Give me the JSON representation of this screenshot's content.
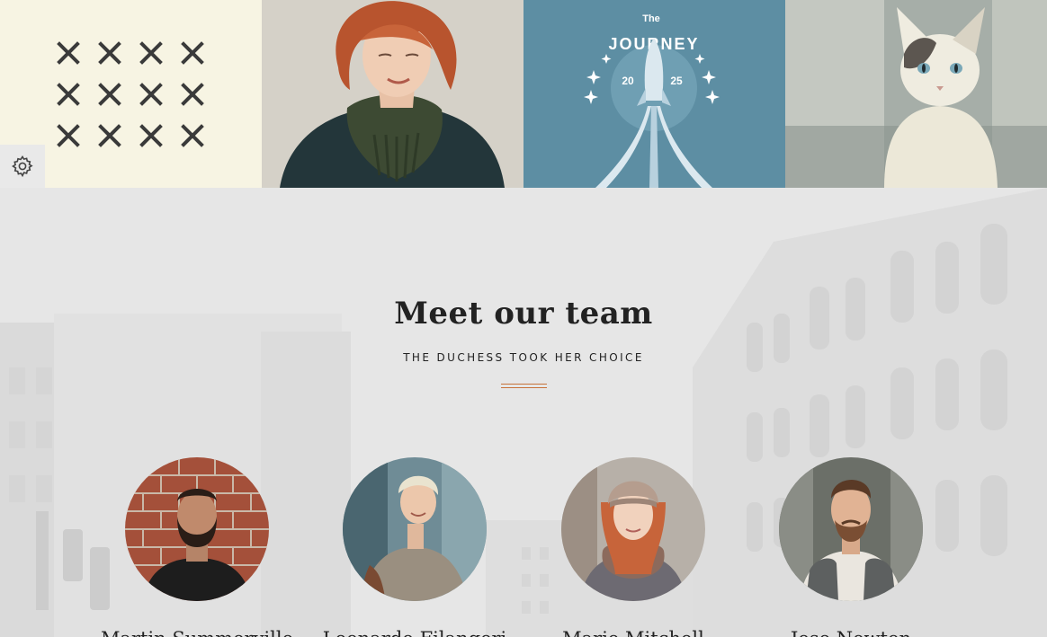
{
  "settings": {
    "icon": "gear-icon"
  },
  "portfolio": {
    "items": [
      {
        "type": "pattern",
        "icon": "x-pattern"
      },
      {
        "type": "photo",
        "subject": "woman"
      },
      {
        "type": "poster",
        "title_small": "The",
        "title_large": "JOURNEY",
        "year_left": "20",
        "year_right": "25"
      },
      {
        "type": "photo",
        "subject": "cat"
      }
    ]
  },
  "team": {
    "title": "Meet our team",
    "subtitle": "THE DUCHESS TOOK HER CHOICE",
    "accent_color": "#c8733b",
    "members": [
      {
        "name": "Martin Summerville"
      },
      {
        "name": "Leonardo Filangeri"
      },
      {
        "name": "Marie Mitchell"
      },
      {
        "name": "Jose Newton"
      }
    ]
  }
}
